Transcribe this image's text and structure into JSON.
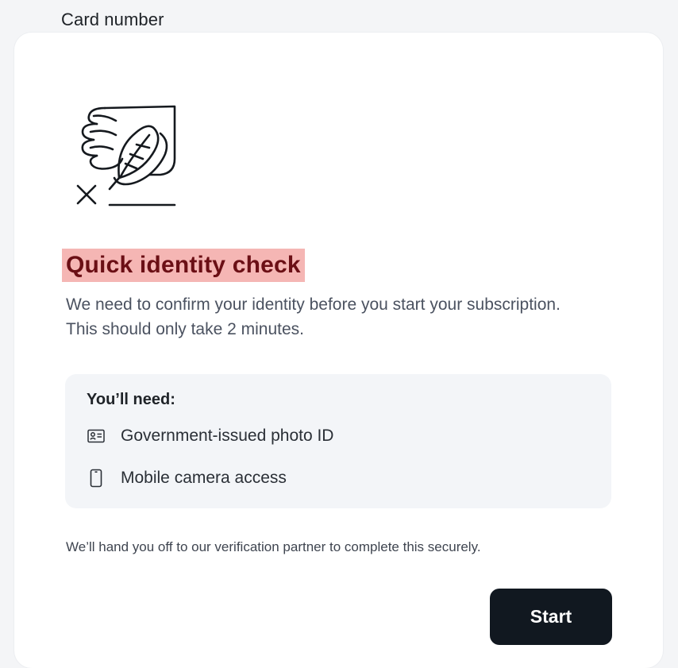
{
  "background": {
    "field_label": "Card number"
  },
  "dialog": {
    "illustration_icon": "signature-document-icon",
    "title": "Quick identity check",
    "description": "We need to confirm your identity before you start your subscription. This should only take 2 minutes.",
    "requirements": {
      "title": "You’ll need:",
      "items": [
        {
          "icon": "id-card-icon",
          "label": "Government-issued photo ID"
        },
        {
          "icon": "mobile-phone-icon",
          "label": "Mobile camera access"
        }
      ]
    },
    "handoff_note": "We’ll hand you off to our verification partner to complete this securely.",
    "start_label": "Start"
  },
  "colors": {
    "page_background": "#f4f5f7",
    "title_highlight": "#f5b6b4",
    "title_text": "#6b0f15",
    "button_background": "#111820",
    "requirements_background": "#f3f5f8"
  }
}
